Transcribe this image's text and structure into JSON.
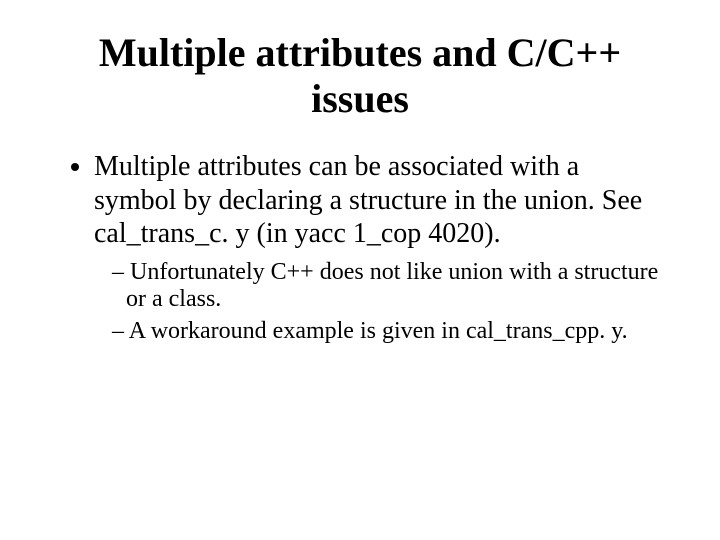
{
  "title": "Multiple attributes and C/C++ issues",
  "bullets": {
    "item1": "Multiple attributes can be associated with a symbol by declaring a structure in the union. See cal_trans_c. y (in yacc 1_cop 4020).",
    "sub1": "Unfortunately C++ does not like union with a structure or a class.",
    "sub2": "A workaround example is given in cal_trans_cpp. y."
  }
}
